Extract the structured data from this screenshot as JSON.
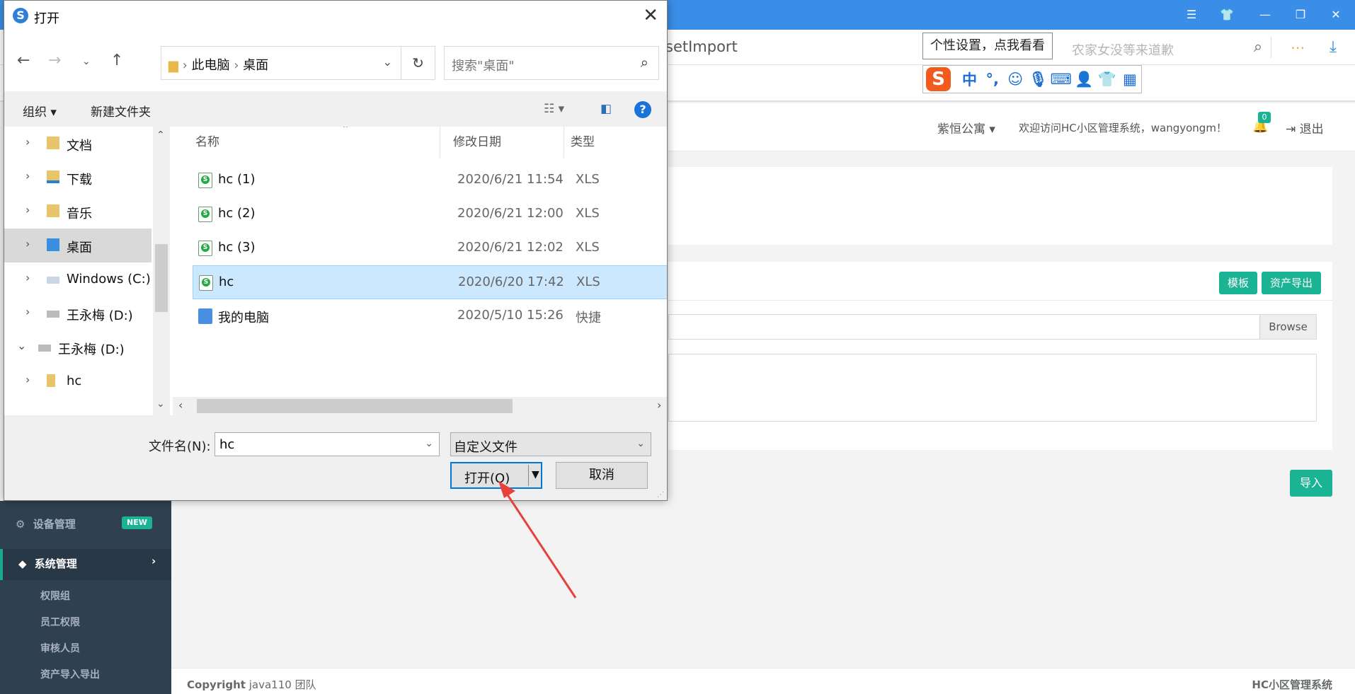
{
  "browser": {
    "url_fragment": "setImport",
    "search_hint": "农家女没等来道歉",
    "ime_tooltip": "个性设置，点我看看",
    "ime_zh_label": "中",
    "ime_punct_label": "°,"
  },
  "app": {
    "community": "紫恒公寓",
    "welcome": "欢迎访问HC小区管理系统，wangyongm！",
    "notify_count": "0",
    "logout": "退出",
    "btn_template": "模板",
    "btn_export": "资产导出",
    "browse_label": "Browse",
    "btn_import": "导入",
    "sidebar": {
      "device": "设备管理",
      "device_badge": "NEW",
      "system": "系统管理",
      "subitems": [
        "权限组",
        "员工权限",
        "审核人员",
        "资产导入导出"
      ]
    },
    "footer_left_bold": "Copyright",
    "footer_left_rest": "java110 团队",
    "footer_right": "HC小区管理系统"
  },
  "dialog": {
    "title": "打开",
    "breadcrumb_root": "此电脑",
    "breadcrumb_current": "桌面",
    "search_placeholder": "搜索\"桌面\"",
    "organize": "组织",
    "new_folder": "新建文件夹",
    "nav_items": [
      {
        "label": "文档"
      },
      {
        "label": "下载"
      },
      {
        "label": "音乐"
      },
      {
        "label": "桌面"
      },
      {
        "label": "Windows (C:)"
      },
      {
        "label": "王永梅 (D:)"
      },
      {
        "label": "王永梅 (D:)"
      },
      {
        "label": "hc"
      }
    ],
    "columns": {
      "name": "名称",
      "date": "修改日期",
      "type": "类型"
    },
    "files": [
      {
        "name": "hc (1)",
        "date": "2020/6/21 11:54",
        "type": "XLS"
      },
      {
        "name": "hc (2)",
        "date": "2020/6/21 12:00",
        "type": "XLS"
      },
      {
        "name": "hc (3)",
        "date": "2020/6/21 12:02",
        "type": "XLS"
      },
      {
        "name": "hc",
        "date": "2020/6/20 17:42",
        "type": "XLS"
      },
      {
        "name": "我的电脑",
        "date": "2020/5/10 15:26",
        "type": "快捷"
      }
    ],
    "filename_label": "文件名(N):",
    "filename_value": "hc",
    "filter_value": "自定义文件",
    "open_label": "打开(O)",
    "cancel_label": "取消"
  },
  "colors": {
    "browser_blue": "#3a8ee8",
    "app_green": "#1ab394",
    "sidebar_bg": "#2f4050",
    "selection": "#cce8ff",
    "annotation_arrow": "#e8403a"
  }
}
